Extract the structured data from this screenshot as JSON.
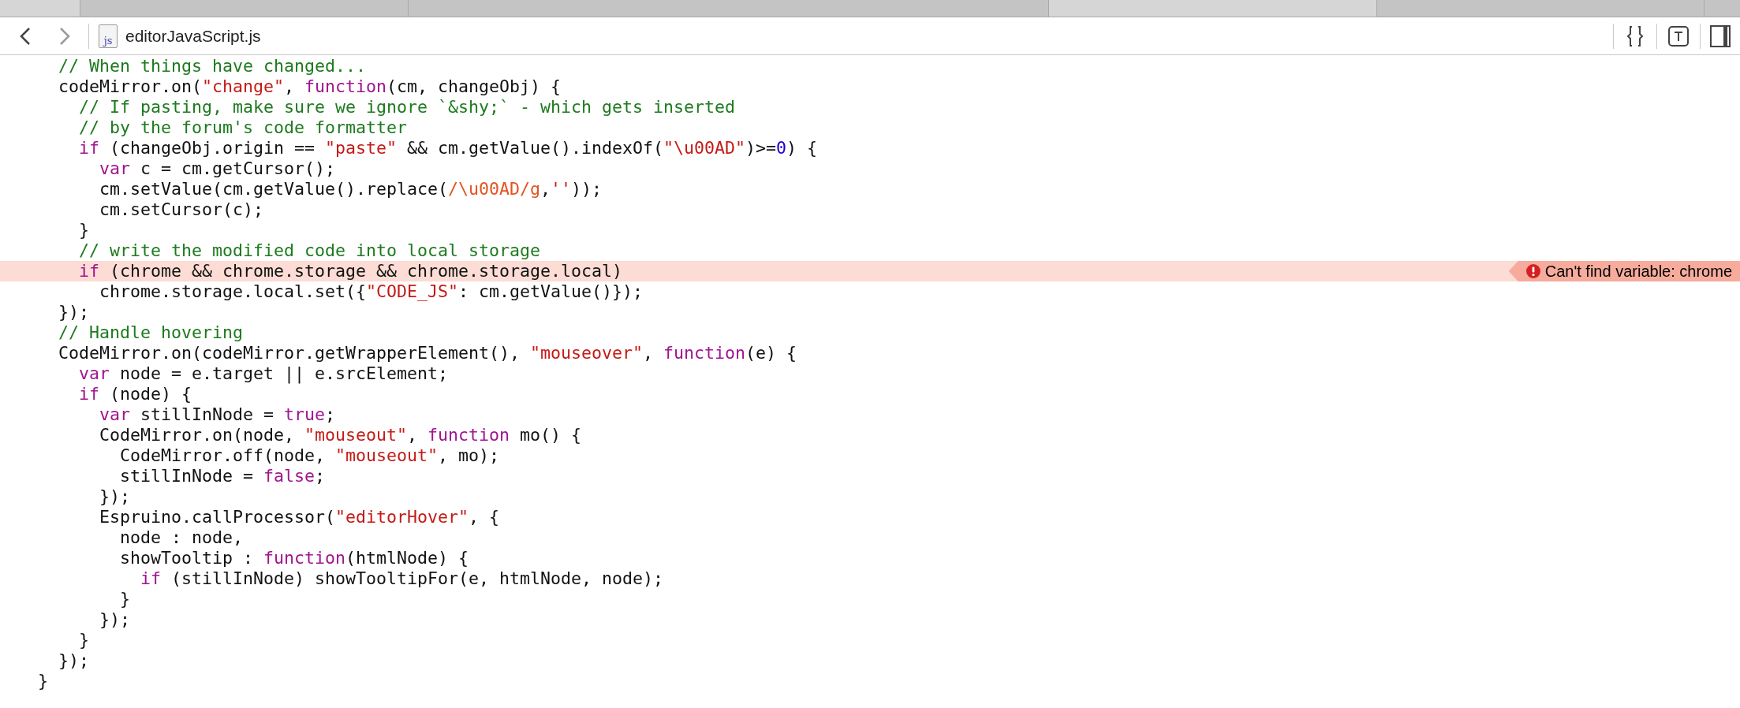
{
  "toolbar": {
    "file_name": "editorJavaScript.js",
    "file_icon_label": "js"
  },
  "code_lines": [
    {
      "highlighted": false,
      "tokens": [
        {
          "kind": "comment",
          "text": "  // When things have changed..."
        }
      ]
    },
    {
      "highlighted": false,
      "tokens": [
        {
          "kind": "plain",
          "text": "  codeMirror.on("
        },
        {
          "kind": "string",
          "text": "\"change\""
        },
        {
          "kind": "plain",
          "text": ", "
        },
        {
          "kind": "keyword",
          "text": "function"
        },
        {
          "kind": "plain",
          "text": "(cm, changeObj) {"
        }
      ]
    },
    {
      "highlighted": false,
      "tokens": [
        {
          "kind": "comment",
          "text": "    // If pasting, make sure we ignore `&shy;` - which gets inserted"
        }
      ]
    },
    {
      "highlighted": false,
      "tokens": [
        {
          "kind": "comment",
          "text": "    // by the forum's code formatter"
        }
      ]
    },
    {
      "highlighted": false,
      "tokens": [
        {
          "kind": "keyword",
          "text": "    if"
        },
        {
          "kind": "plain",
          "text": " (changeObj.origin == "
        },
        {
          "kind": "string",
          "text": "\"paste\""
        },
        {
          "kind": "plain",
          "text": " && cm.getValue().indexOf("
        },
        {
          "kind": "string",
          "text": "\"\\u00AD\""
        },
        {
          "kind": "plain",
          "text": ")>="
        },
        {
          "kind": "number",
          "text": "0"
        },
        {
          "kind": "plain",
          "text": ") {"
        }
      ]
    },
    {
      "highlighted": false,
      "tokens": [
        {
          "kind": "keyword",
          "text": "      var"
        },
        {
          "kind": "plain",
          "text": " c = cm.getCursor();"
        }
      ]
    },
    {
      "highlighted": false,
      "tokens": [
        {
          "kind": "plain",
          "text": "      cm.setValue(cm.getValue().replace("
        },
        {
          "kind": "regex",
          "text": "/\\u00AD/g"
        },
        {
          "kind": "plain",
          "text": ","
        },
        {
          "kind": "string",
          "text": "''"
        },
        {
          "kind": "plain",
          "text": "));"
        }
      ]
    },
    {
      "highlighted": false,
      "tokens": [
        {
          "kind": "plain",
          "text": "      cm.setCursor(c);"
        }
      ]
    },
    {
      "highlighted": false,
      "tokens": [
        {
          "kind": "plain",
          "text": "    }"
        }
      ]
    },
    {
      "highlighted": false,
      "tokens": [
        {
          "kind": "comment",
          "text": "    // write the modified code into local storage"
        }
      ]
    },
    {
      "highlighted": true,
      "error": "Can't find variable: chrome",
      "tokens": [
        {
          "kind": "keyword",
          "text": "    if"
        },
        {
          "kind": "plain",
          "text": " (chrome && chrome.storage && chrome.storage.local)"
        }
      ]
    },
    {
      "highlighted": false,
      "tokens": [
        {
          "kind": "plain",
          "text": "      chrome.storage.local.set({"
        },
        {
          "kind": "string",
          "text": "\"CODE_JS\""
        },
        {
          "kind": "plain",
          "text": ": cm.getValue()});"
        }
      ]
    },
    {
      "highlighted": false,
      "tokens": [
        {
          "kind": "plain",
          "text": "  });"
        }
      ]
    },
    {
      "highlighted": false,
      "tokens": [
        {
          "kind": "comment",
          "text": "  // Handle hovering"
        }
      ]
    },
    {
      "highlighted": false,
      "tokens": [
        {
          "kind": "plain",
          "text": "  CodeMirror.on(codeMirror.getWrapperElement(), "
        },
        {
          "kind": "string",
          "text": "\"mouseover\""
        },
        {
          "kind": "plain",
          "text": ", "
        },
        {
          "kind": "keyword",
          "text": "function"
        },
        {
          "kind": "plain",
          "text": "(e) {"
        }
      ]
    },
    {
      "highlighted": false,
      "tokens": [
        {
          "kind": "keyword",
          "text": "    var"
        },
        {
          "kind": "plain",
          "text": " node = e.target || e.srcElement;"
        }
      ]
    },
    {
      "highlighted": false,
      "tokens": [
        {
          "kind": "keyword",
          "text": "    if"
        },
        {
          "kind": "plain",
          "text": " (node) {"
        }
      ]
    },
    {
      "highlighted": false,
      "tokens": [
        {
          "kind": "keyword",
          "text": "      var"
        },
        {
          "kind": "plain",
          "text": " stillInNode = "
        },
        {
          "kind": "keyword",
          "text": "true"
        },
        {
          "kind": "plain",
          "text": ";"
        }
      ]
    },
    {
      "highlighted": false,
      "tokens": [
        {
          "kind": "plain",
          "text": "      CodeMirror.on(node, "
        },
        {
          "kind": "string",
          "text": "\"mouseout\""
        },
        {
          "kind": "plain",
          "text": ", "
        },
        {
          "kind": "keyword",
          "text": "function"
        },
        {
          "kind": "plain",
          "text": " mo() {"
        }
      ]
    },
    {
      "highlighted": false,
      "tokens": [
        {
          "kind": "plain",
          "text": "        CodeMirror.off(node, "
        },
        {
          "kind": "string",
          "text": "\"mouseout\""
        },
        {
          "kind": "plain",
          "text": ", mo);"
        }
      ]
    },
    {
      "highlighted": false,
      "tokens": [
        {
          "kind": "plain",
          "text": "        stillInNode = "
        },
        {
          "kind": "keyword",
          "text": "false"
        },
        {
          "kind": "plain",
          "text": ";"
        }
      ]
    },
    {
      "highlighted": false,
      "tokens": [
        {
          "kind": "plain",
          "text": "      });"
        }
      ]
    },
    {
      "highlighted": false,
      "tokens": [
        {
          "kind": "plain",
          "text": "      Espruino.callProcessor("
        },
        {
          "kind": "string",
          "text": "\"editorHover\""
        },
        {
          "kind": "plain",
          "text": ", {"
        }
      ]
    },
    {
      "highlighted": false,
      "tokens": [
        {
          "kind": "plain",
          "text": "        node : node,"
        }
      ]
    },
    {
      "highlighted": false,
      "tokens": [
        {
          "kind": "plain",
          "text": "        showTooltip : "
        },
        {
          "kind": "keyword",
          "text": "function"
        },
        {
          "kind": "plain",
          "text": "(htmlNode) {"
        }
      ]
    },
    {
      "highlighted": false,
      "tokens": [
        {
          "kind": "keyword",
          "text": "          if"
        },
        {
          "kind": "plain",
          "text": " (stillInNode) showTooltipFor(e, htmlNode, node);"
        }
      ]
    },
    {
      "highlighted": false,
      "tokens": [
        {
          "kind": "plain",
          "text": "        }"
        }
      ]
    },
    {
      "highlighted": false,
      "tokens": [
        {
          "kind": "plain",
          "text": "      });"
        }
      ]
    },
    {
      "highlighted": false,
      "tokens": [
        {
          "kind": "plain",
          "text": "    }"
        }
      ]
    },
    {
      "highlighted": false,
      "tokens": [
        {
          "kind": "plain",
          "text": "  });"
        }
      ]
    },
    {
      "highlighted": false,
      "tokens": [
        {
          "kind": "plain",
          "text": "}"
        }
      ]
    }
  ]
}
